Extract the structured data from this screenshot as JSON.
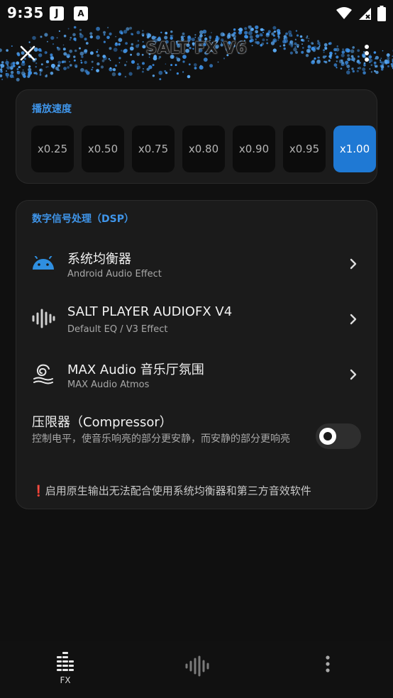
{
  "status_bar": {
    "time": "9:35",
    "app_icons": [
      "J",
      "A"
    ]
  },
  "header": {
    "title": "SALT FX V6",
    "subtitle": ""
  },
  "playback_speed": {
    "title": "播放速度",
    "options": [
      "x0.25",
      "x0.50",
      "x0.75",
      "x0.80",
      "x0.90",
      "x0.95",
      "x1.00"
    ],
    "selected": "x1.00"
  },
  "dsp": {
    "title": "数字信号处理（DSP）",
    "items": [
      {
        "title": "系统均衡器",
        "subtitle": "Android Audio Effect",
        "icon": "android-icon"
      },
      {
        "title": "SALT PLAYER AUDIOFX V4",
        "subtitle": "Default EQ / V3 Effect",
        "icon": "waveform-icon"
      },
      {
        "title": "MAX Audio 音乐厅氛围",
        "subtitle": "MAX Audio Atmos",
        "icon": "atmos-swirl-icon"
      }
    ],
    "compressor": {
      "title": "压限器（Compressor）",
      "description": "控制电平，使音乐响亮的部分更安静，而安静的部分更响亮",
      "enabled": false
    },
    "warning": {
      "mark": "❗",
      "text": "启用原生输出无法配合使用系统均衡器和第三方音效软件"
    }
  },
  "bottom_nav": {
    "items": [
      {
        "label": "FX",
        "icon": "equalizer-bars-icon"
      },
      {
        "label": "",
        "icon": "waveform-icon"
      },
      {
        "label": "",
        "icon": "more-vertical-icon"
      }
    ]
  },
  "colors": {
    "accent": "#3f95ea",
    "selected_chip": "#1f79d4",
    "android_green": "#2f8fe0",
    "warning": "#e03030",
    "background": "#101010",
    "card": "#1b1b1b"
  }
}
